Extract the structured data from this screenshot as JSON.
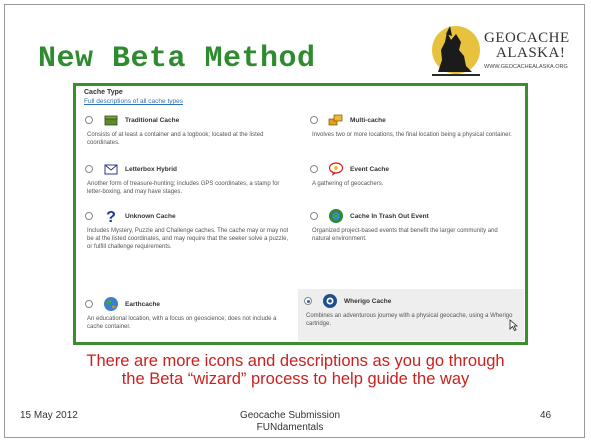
{
  "slide": {
    "title": "New Beta Method",
    "caption_line1": "There are more icons and descriptions as you go through",
    "caption_line2": "the Beta “wizard” process to help guide the way",
    "footer": {
      "date": "15 May 2012",
      "center_line1": "Geocache Submission",
      "center_line2": "FUNdamentals",
      "page_number": "46"
    }
  },
  "logo": {
    "line1": "GEOCACHE",
    "line2": "ALASKA!",
    "url": "WWW.GEOCACHEALASKA.ORG",
    "icon": "howling-wolf-icon"
  },
  "cache_panel": {
    "heading": "Cache Type",
    "link_label": "Full descriptions of all cache types",
    "options": [
      {
        "name": "Traditional Cache",
        "description": "Consists of at least a container and a logbook; located at the listed coordinates.",
        "icon": "traditional-cache-icon",
        "selected": false
      },
      {
        "name": "Multi-cache",
        "description": "Involves two or more locations, the final location being a physical container.",
        "icon": "multi-cache-icon",
        "selected": false
      },
      {
        "name": "Letterbox Hybrid",
        "description": "Another form of treasure-hunting; includes GPS coordinates, a stamp for letter-boxing, and may have stages.",
        "icon": "letterbox-icon",
        "selected": false
      },
      {
        "name": "Event Cache",
        "description": "A gathering of geocachers.",
        "icon": "event-cache-icon",
        "selected": false
      },
      {
        "name": "Unknown Cache",
        "description": "Includes Mystery, Puzzle and Challenge caches. The cache may or may not be at the listed coordinates, and may require that the seeker solve a puzzle, or fulfill challenge requirements.",
        "icon": "question-mark-icon",
        "selected": false
      },
      {
        "name": "Cache In Trash Out Event",
        "description": "Organized project-based events that benefit the larger community and natural environment.",
        "icon": "cito-icon",
        "selected": false
      },
      {
        "name": "Earthcache",
        "description": "An educational location, with a focus on geoscience; does not include a cache container.",
        "icon": "earthcache-icon",
        "selected": false
      },
      {
        "name": "Wherigo Cache",
        "description": "Combines an adventurous journey with a physical geocache, using a Wherigo cartridge.",
        "icon": "wherigo-icon",
        "selected": true
      }
    ]
  },
  "colors": {
    "title": "#2e8b30",
    "panel_border": "#3b8e2e",
    "caption": "#cc1f1f",
    "link": "#2f6fb5"
  }
}
